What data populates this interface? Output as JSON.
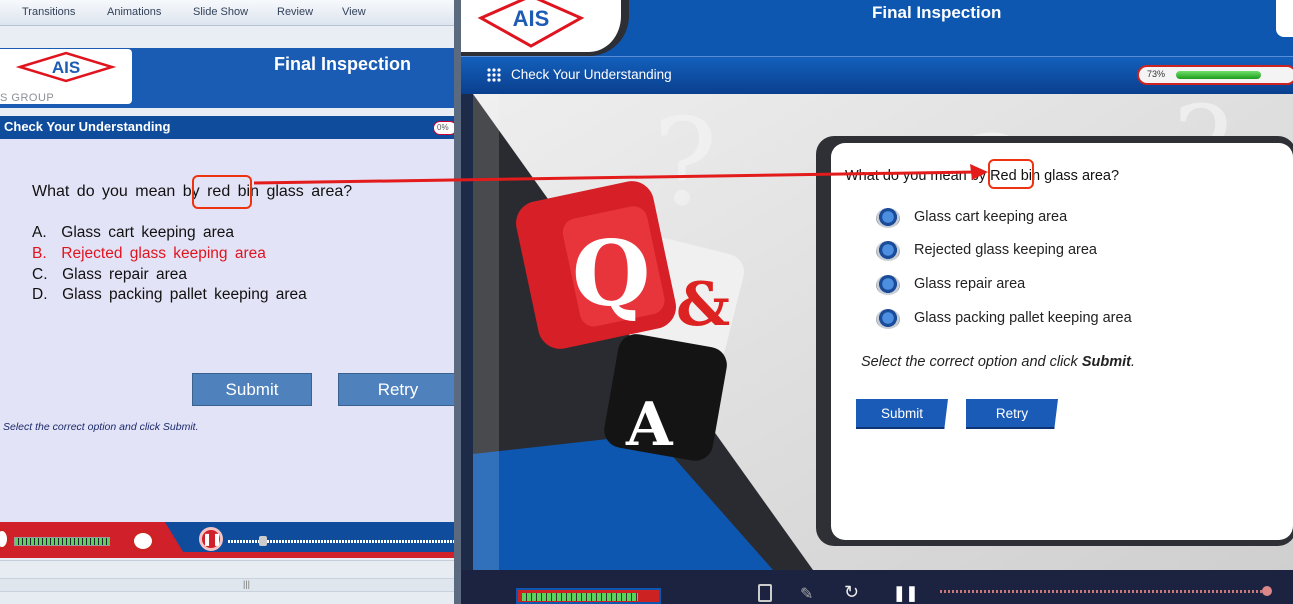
{
  "left_pane": {
    "ribbon_tabs": [
      "Transitions",
      "Animations",
      "Slide Show",
      "Review",
      "View"
    ],
    "logo_text": "AIS",
    "group_text": "S GROUP",
    "title": "Final Inspection",
    "subtitle": "Check Your Understanding",
    "progress_label": "0%",
    "question": "What do you mean  by red bin glass  area?",
    "options": [
      {
        "letter": "A.",
        "text": "Glass  cart keeping  area"
      },
      {
        "letter": "B.",
        "text": "Rejected  glass keeping area"
      },
      {
        "letter": "C.",
        "text": "Glass  repair area"
      },
      {
        "letter": "D.",
        "text": "Glass  packing pallet keeping area"
      }
    ],
    "submit_label": "Submit",
    "retry_label": "Retry",
    "hint": "Select the correct option and click Submit.",
    "scroll_grip": "|||"
  },
  "right_pane": {
    "logo_text": "AIS",
    "title": "Final Inspection",
    "subtitle": "Check Your Understanding",
    "progress": {
      "label": "73%",
      "fraction": 0.73
    },
    "question": "What do you mean by Red bin glass area?",
    "options": [
      "Glass cart keeping area",
      "Rejected glass keeping area",
      "Glass repair area",
      "Glass packing pallet keeping area"
    ],
    "hint_prefix": "Select the correct option and click ",
    "hint_bold": "Submit",
    "hint_suffix": ".",
    "submit_label": "Submit",
    "retry_label": "Retry"
  },
  "colors": {
    "brand_blue": "#0d57b0",
    "accent_red": "#e0141e",
    "annotation_red": "#e31b1b"
  },
  "icons": [
    "grid-icon",
    "notes-icon",
    "pencil-icon",
    "replay-icon",
    "pause-icon",
    "volume-icon",
    "chat-icon"
  ]
}
